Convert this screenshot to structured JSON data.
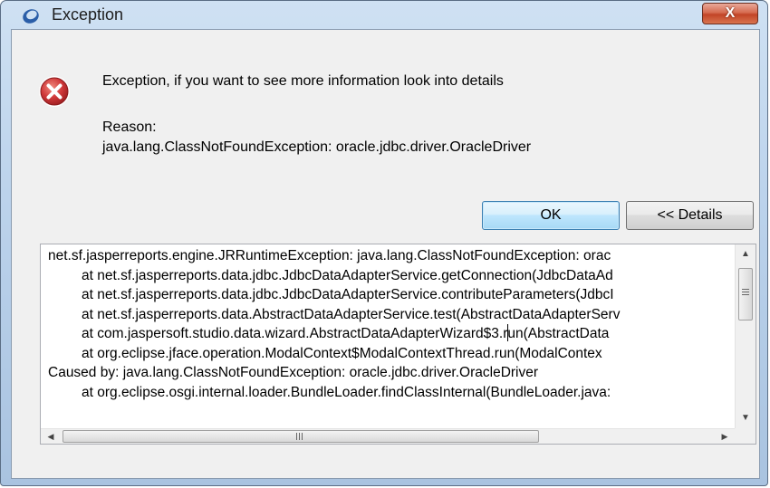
{
  "window": {
    "title": "Exception",
    "close_label": "X"
  },
  "message": "Exception, if you want to see more information look into details",
  "reason": {
    "label": "Reason:",
    "text": "java.lang.ClassNotFoundException: oracle.jdbc.driver.OracleDriver"
  },
  "buttons": {
    "ok": "OK",
    "details": "<< Details"
  },
  "details": {
    "lines": [
      "net.sf.jasperreports.engine.JRRuntimeException: java.lang.ClassNotFoundException: orac",
      "at net.sf.jasperreports.data.jdbc.JdbcDataAdapterService.getConnection(JdbcDataAd",
      "at net.sf.jasperreports.data.jdbc.JdbcDataAdapterService.contributeParameters(JdbcI",
      "at net.sf.jasperreports.data.AbstractDataAdapterService.test(AbstractDataAdapterServ",
      "at com.jaspersoft.studio.data.wizard.AbstractDataAdapterWizard$3.run(AbstractData",
      "at org.eclipse.jface.operation.ModalContext$ModalContextThread.run(ModalContex",
      "Caused by: java.lang.ClassNotFoundException: oracle.jdbc.driver.OracleDriver",
      "at org.eclipse.osgi.internal.loader.BundleLoader.findClassInternal(BundleLoader.java:"
    ],
    "scroll_arrows": {
      "up": "▲",
      "down": "▼",
      "left": "◀",
      "right": "▶"
    }
  },
  "colors": {
    "error_red": "#c0262a",
    "titlebar": "#bcd3ec",
    "close_button": "#c24427",
    "ok_border": "#3c7fb1"
  }
}
